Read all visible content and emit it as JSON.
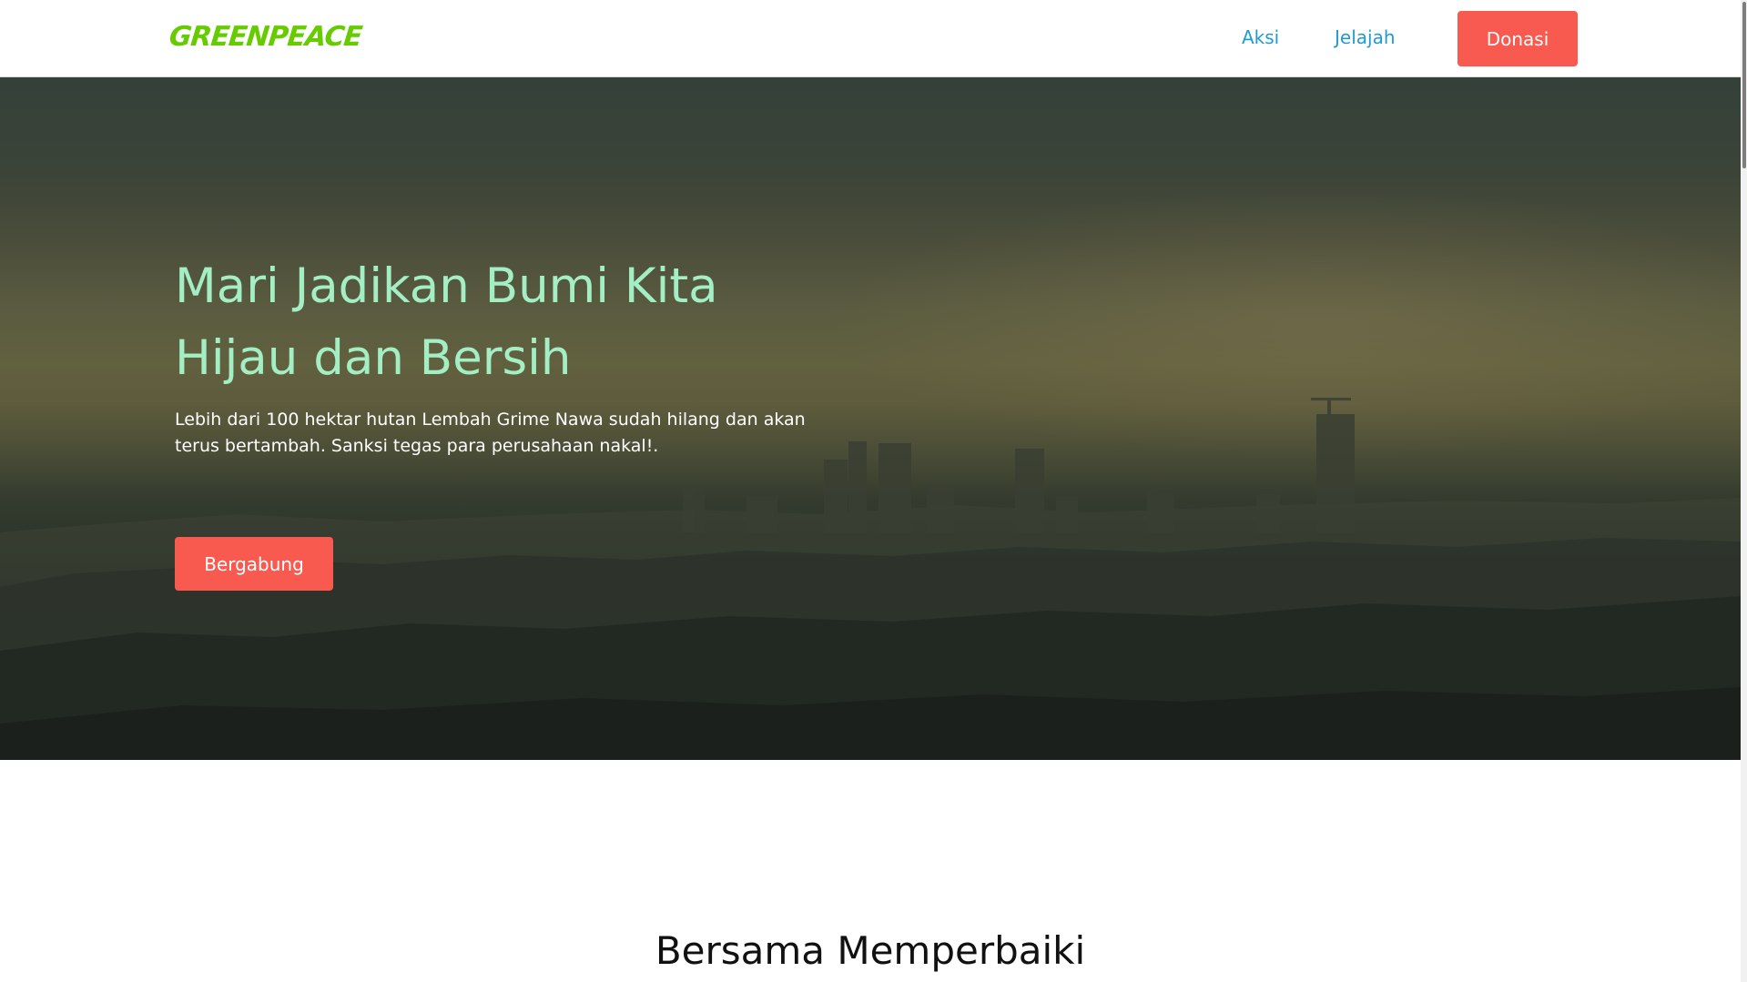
{
  "navbar": {
    "logo": "GREENPEACE",
    "links": [
      {
        "label": "Aksi"
      },
      {
        "label": "Jelajah"
      }
    ],
    "donate_label": "Donasi"
  },
  "hero": {
    "title_line1": "Mari Jadikan Bumi Kita",
    "title_line2": "Hijau dan Bersih",
    "description": "Lebih dari 100 hektar hutan Lembah Grime Nawa sudah hilang dan akan terus bertambah. Sanksi tegas para perusahaan nakal!.",
    "cta_label": "Bergabung"
  },
  "section": {
    "title": "Bersama Memperbaiki"
  },
  "colors": {
    "accent_button": "#f85a50",
    "nav_link": "#1f9bd1",
    "hero_title": "#a3efc3",
    "logo_green": "#66cc00"
  }
}
